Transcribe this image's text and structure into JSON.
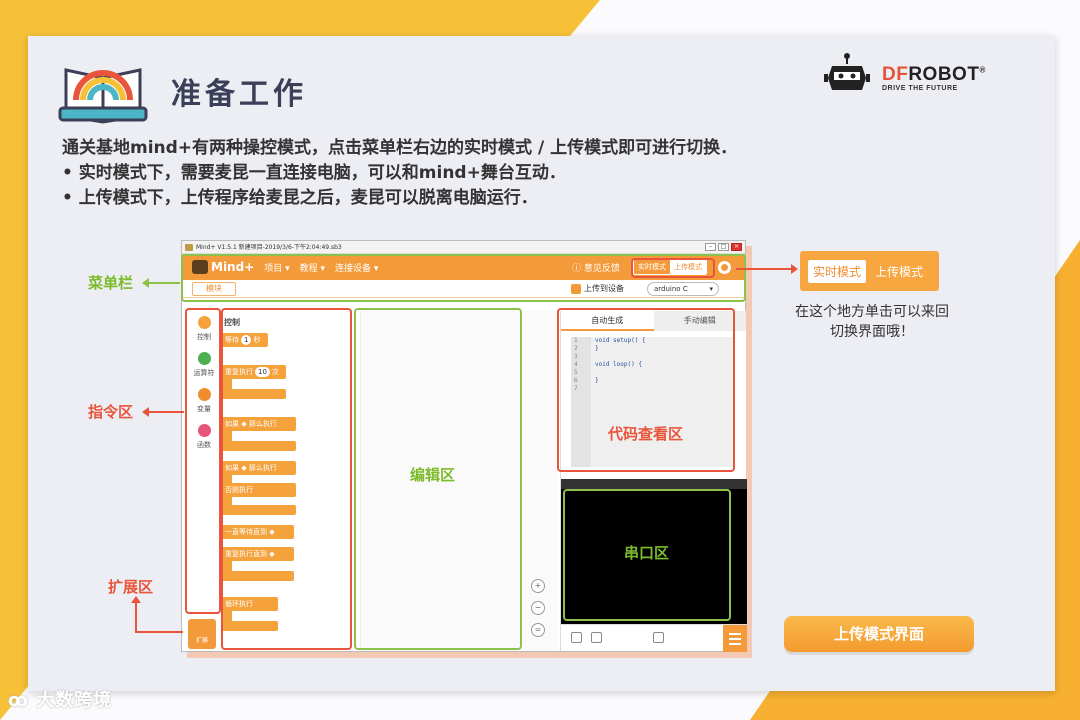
{
  "title": "准备工作",
  "brand": {
    "logo_df": "DF",
    "logo_robot": "ROBOT",
    "logo_mark": "®",
    "tagline": "DRIVE THE FUTURE"
  },
  "description": {
    "line1": "通关基地mind+有两种操控模式，点击菜单栏右边的实时模式 / 上传模式即可进行切换．",
    "line2": "• 实时模式下，需要麦昆一直连接电脑，可以和mind+舞台互动．",
    "line3": "• 上传模式下，上传程序给麦昆之后，麦昆可以脱离电脑运行．"
  },
  "app": {
    "window_title": "Mind+ V1.5.1    新建项目-2019/3/6-下午2:04:49.sb3",
    "logo": "Mind+",
    "menu": [
      "项目 ▾",
      "教程 ▾",
      "连接设备 ▾"
    ],
    "feedback": "意见反馈",
    "mode_realtime": "实时模式",
    "mode_upload": "上传模式",
    "tab_modules": "模块",
    "upload_to_device": "上传到设备",
    "board": "arduino C",
    "categories": [
      {
        "label": "控制",
        "color": "#f5a23d"
      },
      {
        "label": "运算符",
        "color": "#4caf50"
      },
      {
        "label": "变量",
        "color": "#f08c2e"
      },
      {
        "label": "函数",
        "color": "#e8557a"
      }
    ],
    "blocks_header": "控制",
    "blocks": {
      "wait": "等待",
      "wait_val": "1",
      "wait_unit": "秒",
      "repeat": "重复执行",
      "repeat_val": "10",
      "repeat_unit": "次",
      "if_then": "如果",
      "then_do": "那么执行",
      "if2": "如果",
      "then2": "那么执行",
      "else": "否则执行",
      "wait_until": "一直等待直到",
      "repeat_until": "重复执行直到",
      "forever": "循环执行"
    },
    "code_tabs": [
      "自动生成",
      "手动编辑"
    ],
    "code_lines": [
      "1",
      "2",
      "3",
      "4",
      "5",
      "6",
      "7"
    ],
    "code_text": [
      "void setup() {",
      "}",
      "",
      "void loop() {",
      "",
      "}",
      ""
    ],
    "extension": "扩展"
  },
  "labels": {
    "menubar": "菜单栏",
    "command_area": "指令区",
    "extension_area": "扩展区",
    "edit_area": "编辑区",
    "code_view": "代码查看区",
    "serial_area": "串口区"
  },
  "callout": {
    "realtime": "实时模式",
    "upload": "上传模式",
    "note": "在这个地方单击可以来回切换界面哦！"
  },
  "upload_mode_button": "上传模式界面",
  "watermark": "大数跨境"
}
